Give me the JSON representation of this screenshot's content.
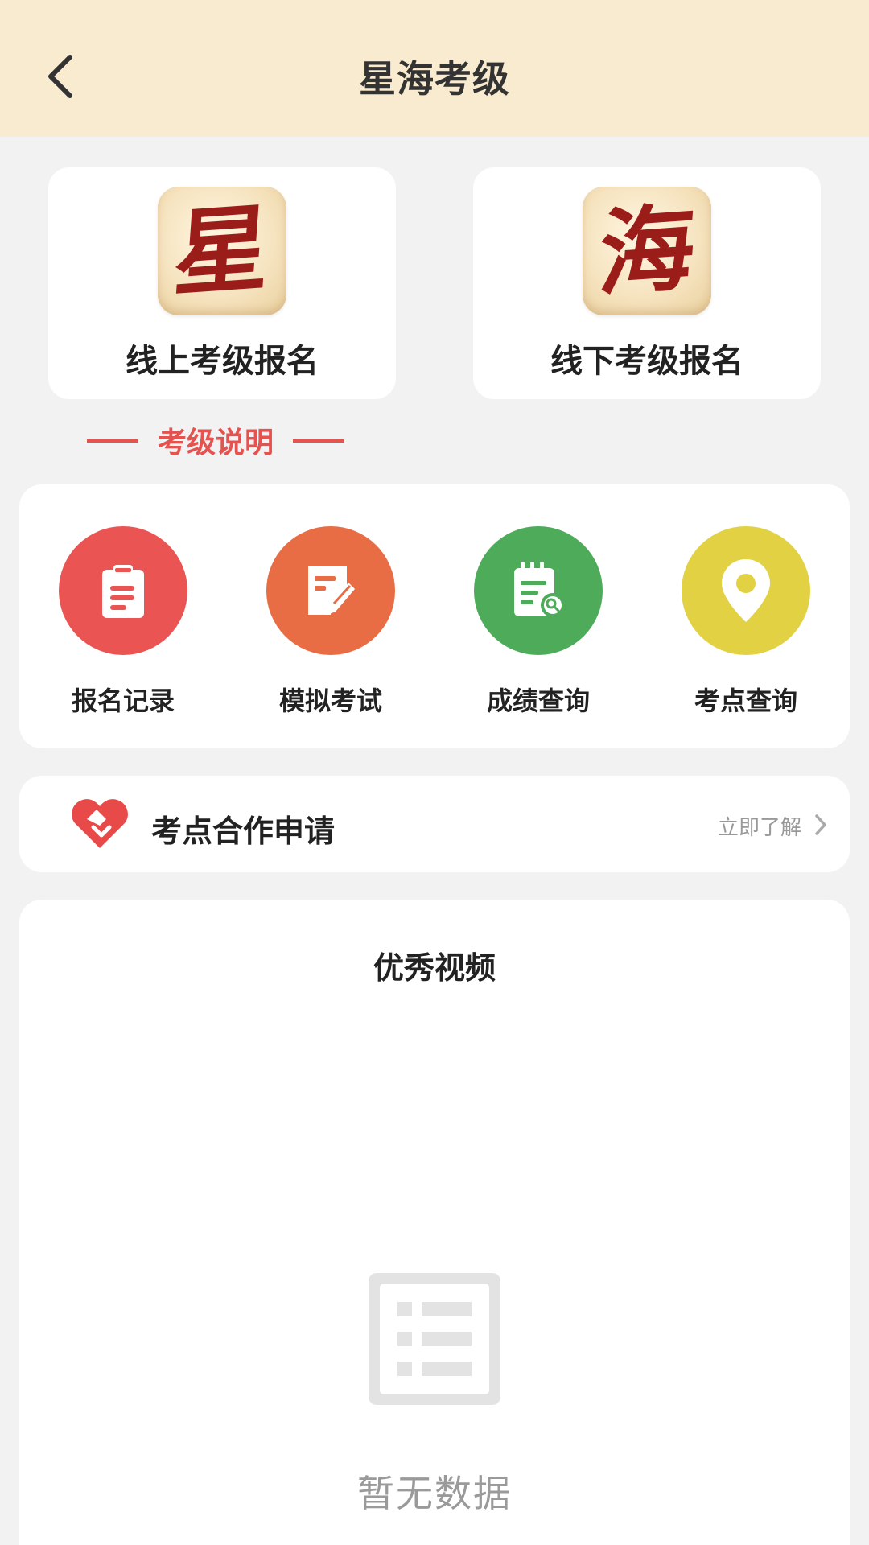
{
  "header": {
    "title": "星海考级"
  },
  "registration": {
    "online": {
      "seal_char": "星",
      "label": "线上考级报名"
    },
    "offline": {
      "seal_char": "海",
      "label": "线下考级报名"
    }
  },
  "exam_description": {
    "label": "考级说明"
  },
  "features": [
    {
      "label": "报名记录",
      "icon": "clipboard-icon",
      "color": "#ea5453"
    },
    {
      "label": "模拟考试",
      "icon": "edit-form-icon",
      "color": "#e86d45"
    },
    {
      "label": "成绩查询",
      "icon": "notebook-search-icon",
      "color": "#4dab5a"
    },
    {
      "label": "考点查询",
      "icon": "map-pin-icon",
      "color": "#e2d142"
    }
  ],
  "cooperation": {
    "label": "考点合作申请",
    "more": "立即了解",
    "icon": "handshake-heart-icon",
    "color": "#e84a4a"
  },
  "videos": {
    "title": "优秀视频",
    "empty_text": "暂无数据"
  }
}
